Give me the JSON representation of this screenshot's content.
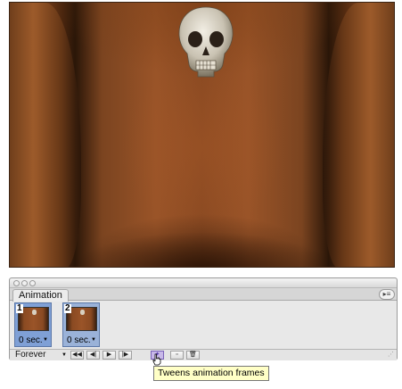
{
  "palette": {
    "tab_label": "Animation",
    "frames": [
      {
        "number": "1",
        "delay": "0 sec.",
        "selected": true
      },
      {
        "number": "2",
        "delay": "0 sec.",
        "selected": false
      }
    ],
    "controls": {
      "loop_option": "Forever",
      "buttons": [
        {
          "icon": "first-frame-icon",
          "glyph": "◀◀"
        },
        {
          "icon": "previous-frame-icon",
          "glyph": "◀|"
        },
        {
          "icon": "play-icon",
          "glyph": "▶"
        },
        {
          "icon": "next-frame-icon",
          "glyph": "|▶"
        },
        {
          "icon": "tween-icon",
          "glyph": "✦"
        },
        {
          "icon": "duplicate-frame-icon",
          "glyph": "▫"
        },
        {
          "icon": "trash-icon",
          "glyph": "🗑"
        }
      ]
    }
  },
  "tooltip": {
    "text": "Tweens animation frames"
  },
  "colors": {
    "frame_selected": "#7fa0d6",
    "tooltip_bg": "#ffffc6",
    "rock": "#8b4a22"
  }
}
